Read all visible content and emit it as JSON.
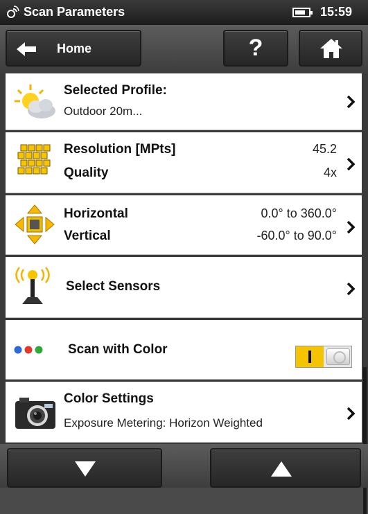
{
  "status_bar": {
    "title": "Scan Parameters",
    "time": "15:59",
    "battery_level": 0.75
  },
  "nav": {
    "home_label": "Home",
    "help_label": "?"
  },
  "rows": {
    "profile": {
      "label": "Selected Profile:",
      "value": "Outdoor 20m...",
      "icon": "weather-sun-cloud-icon"
    },
    "resolution": {
      "label1": "Resolution [MPts]",
      "value1": "45.2",
      "label2": "Quality",
      "value2": "4x",
      "icon": "resolution-grid-icon"
    },
    "field_of_view": {
      "label1": "Horizontal",
      "value1": "0.0° to 360.0°",
      "label2": "Vertical",
      "value2": "-60.0° to 90.0°",
      "icon": "direction-arrows-icon"
    },
    "sensors": {
      "label": "Select Sensors",
      "icon": "sensor-antenna-icon"
    },
    "scan_color": {
      "label": "Scan with Color",
      "enabled": true,
      "icon": "color-dots-icon"
    },
    "color_settings": {
      "label": "Color Settings",
      "value": "Exposure Metering: Horizon Weighted",
      "icon": "camera-icon"
    }
  },
  "colors": {
    "accent": "#f5c400",
    "background": "#4a4a4a",
    "row": "#ffffff",
    "dot_blue": "#2a6bd6",
    "dot_red": "#e03a2a",
    "dot_green": "#2faa3a"
  }
}
